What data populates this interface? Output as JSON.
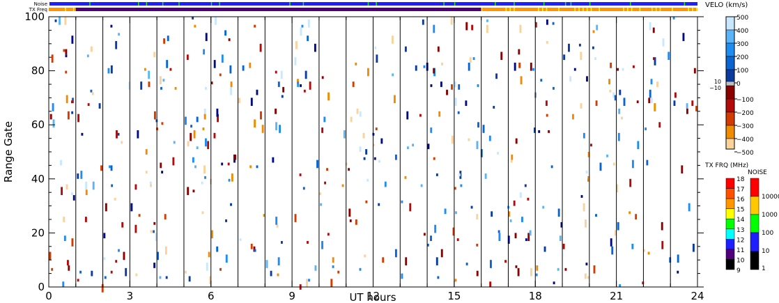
{
  "chart_data": {
    "type": "heatmap",
    "xlabel": "UT hours",
    "ylabel": "Range Gate",
    "xlim": [
      0,
      24
    ],
    "ylim": [
      0,
      100
    ],
    "xticks": [
      "0",
      "3",
      "6",
      "9",
      "12",
      "15",
      "18",
      "21",
      "24"
    ],
    "yticks": [
      "0",
      "20",
      "40",
      "60",
      "80",
      "100"
    ],
    "strip_labels": {
      "noise": "Noise",
      "txfreq": "TX Freq"
    },
    "velocity_scale": {
      "title": "VELO (km/s)",
      "ticks": [
        "500",
        "400",
        "300",
        "200",
        "100",
        "0",
        "−100",
        "−200",
        "−300",
        "−400",
        "−500"
      ],
      "ground_scatter_labels": [
        "10",
        "−10"
      ],
      "colors": [
        "#c8e8ff",
        "#5ab4f8",
        "#1e8cf0",
        "#0a64d2",
        "#0a3ca0",
        "#000a82",
        "#8c0000",
        "#b40a0a",
        "#d23c00",
        "#f08c00",
        "#fad29c"
      ]
    },
    "txfreq_scale": {
      "title": "TX FRQ (MHz)",
      "ticks": [
        "18",
        "17",
        "16",
        "15",
        "14",
        "13",
        "12",
        "11",
        "10",
        "9"
      ],
      "colors": [
        "#ff0000",
        "#ff5000",
        "#ff9600",
        "#ffff00",
        "#00ff00",
        "#00ffff",
        "#1e1eff",
        "#500078",
        "#000000"
      ]
    },
    "noise_scale": {
      "title": "NOISE",
      "ticks": [
        "10000",
        "1000",
        "100",
        "10",
        "1"
      ],
      "colors": [
        "#ff0000",
        "#ffc800",
        "#00ff00",
        "#1e1eff",
        "#000000"
      ]
    },
    "txfreq_segments": [
      {
        "from": 0,
        "to": 1,
        "mhz": 15
      },
      {
        "from": 1,
        "to": 16,
        "mhz": 10
      },
      {
        "from": 16,
        "to": 24,
        "mhz": 15
      }
    ],
    "noise_spikes_hours": [
      1.5,
      3.3,
      3.6,
      4.2,
      4.8,
      6.0,
      6.3,
      8.9,
      9.4,
      11.8,
      12.1,
      14.6,
      15.0,
      16.5,
      17.2,
      18.3,
      19.1,
      19.3,
      20.0,
      21.5,
      23.5
    ],
    "echo_regions": [
      {
        "hours": [
          0,
          1
        ],
        "gates": [
          38,
          50
        ],
        "velocity": "ground",
        "density": 0.5
      },
      {
        "hours": [
          0.4,
          2
        ],
        "gates": [
          24,
          42
        ],
        "velocity": -150,
        "density": 0.45
      },
      {
        "hours": [
          1.7,
          3.2
        ],
        "gates": [
          8,
          12
        ],
        "velocity": 50,
        "density": 0.75
      },
      {
        "hours": [
          1.8,
          5
        ],
        "gates": [
          11,
          28
        ],
        "velocity": 60,
        "density": 0.7
      },
      {
        "hours": [
          2.2,
          3.5
        ],
        "gates": [
          28,
          45
        ],
        "velocity": 80,
        "density": 0.25
      },
      {
        "hours": [
          4.5,
          6.5
        ],
        "gates": [
          13,
          22
        ],
        "velocity": "ground",
        "density": 0.4
      },
      {
        "hours": [
          5,
          6.7
        ],
        "gates": [
          16,
          22
        ],
        "velocity": 60,
        "density": 0.35
      },
      {
        "hours": [
          3.3,
          4.5
        ],
        "gates": [
          45,
          60
        ],
        "velocity": -120,
        "density": 0.35
      },
      {
        "hours": [
          4.2,
          5.2
        ],
        "gates": [
          58,
          72
        ],
        "velocity": -130,
        "density": 0.35
      },
      {
        "hours": [
          6.5,
          7
        ],
        "gates": [
          62,
          70
        ],
        "velocity": -150,
        "density": 0.4
      },
      {
        "hours": [
          7,
          10
        ],
        "gates": [
          52,
          74
        ],
        "velocity": "ground",
        "density": 0.35
      },
      {
        "hours": [
          7,
          10
        ],
        "gates": [
          54,
          72
        ],
        "velocity": -150,
        "density": 0.3
      },
      {
        "hours": [
          10,
          13.5
        ],
        "gates": [
          58,
          80
        ],
        "velocity": "ground",
        "density": 0.35
      },
      {
        "hours": [
          10,
          13.5
        ],
        "gates": [
          60,
          78
        ],
        "velocity": -140,
        "density": 0.35
      },
      {
        "hours": [
          13.5,
          15.2
        ],
        "gates": [
          74,
          88
        ],
        "velocity": 80,
        "density": 0.4
      },
      {
        "hours": [
          15,
          16
        ],
        "gates": [
          24,
          46
        ],
        "velocity": "ground",
        "density": 0.4
      },
      {
        "hours": [
          15,
          15.8
        ],
        "gates": [
          25,
          46
        ],
        "velocity": 60,
        "density": 0.3
      },
      {
        "hours": [
          14,
          15
        ],
        "gates": [
          23,
          26
        ],
        "velocity": -120,
        "density": 0.6
      },
      {
        "hours": [
          17.5,
          24
        ],
        "gates": [
          27,
          52
        ],
        "velocity": "ground",
        "density": 0.5
      },
      {
        "hours": [
          22.5,
          24
        ],
        "gates": [
          44,
          52
        ],
        "velocity": -130,
        "density": 0.3
      },
      {
        "hours": [
          16,
          18
        ],
        "gates": [
          78,
          96
        ],
        "velocity": -420,
        "density": 0.12
      },
      {
        "hours": [
          0,
          24
        ],
        "gates": [
          0,
          5
        ],
        "velocity": -140,
        "density": 0.3
      }
    ]
  }
}
